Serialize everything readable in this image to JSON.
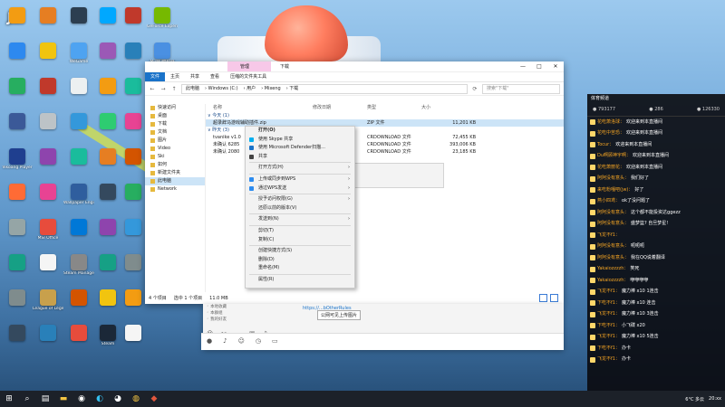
{
  "desktop": {
    "logo": "JD",
    "icons": [
      {
        "label": "",
        "color": "#f39c12"
      },
      {
        "label": "",
        "color": "#2d89ef"
      },
      {
        "label": "",
        "color": "#27ae60"
      },
      {
        "label": "",
        "color": "#3b5998"
      },
      {
        "label": "Vikoang Player",
        "color": "#1f3f8f"
      },
      {
        "label": "",
        "color": "#ff6b35"
      },
      {
        "label": "",
        "color": "#95a5a6"
      },
      {
        "label": "",
        "color": "#16a085"
      },
      {
        "label": "",
        "color": "#7f8c8d"
      },
      {
        "label": "",
        "color": "#34495e"
      },
      {
        "label": "",
        "color": "#e67e22"
      },
      {
        "label": "",
        "color": "#f1c40f"
      },
      {
        "label": "",
        "color": "#c0392b"
      },
      {
        "label": "",
        "color": "#bdc3c7"
      },
      {
        "label": "",
        "color": "#8e44ad"
      },
      {
        "label": "",
        "color": "#e84393"
      },
      {
        "label": "MSI Office",
        "color": "#e74c3c"
      },
      {
        "label": "",
        "color": "#f5f5f5"
      },
      {
        "label": "League of Legends",
        "color": "#c8a04c"
      },
      {
        "label": "",
        "color": "#2980b9"
      },
      {
        "label": "",
        "color": "#2c3e50"
      },
      {
        "label": "WeGame",
        "color": "#4ea3f1"
      },
      {
        "label": "",
        "color": "#ecf0f1"
      },
      {
        "label": "",
        "color": "#3498db"
      },
      {
        "label": "",
        "color": "#1abc9c"
      },
      {
        "label": "Wallpaper Engine",
        "color": "#2f5e9e"
      },
      {
        "label": "",
        "color": "#0078d7"
      },
      {
        "label": "Steam Manager",
        "color": "#888888"
      },
      {
        "label": "",
        "color": "#d35400"
      },
      {
        "label": "",
        "color": "#e74c3c"
      },
      {
        "label": "",
        "color": "#00a8ff"
      },
      {
        "label": "",
        "color": "#9b59b6"
      },
      {
        "label": "",
        "color": "#f39c12"
      },
      {
        "label": "",
        "color": "#2ecc71"
      },
      {
        "label": "",
        "color": "#e67e22"
      },
      {
        "label": "",
        "color": "#34495e"
      },
      {
        "label": "",
        "color": "#8e44ad"
      },
      {
        "label": "",
        "color": "#16a085"
      },
      {
        "label": "",
        "color": "#f1c40f"
      },
      {
        "label": "Steam",
        "color": "#1b2838"
      },
      {
        "label": "",
        "color": "#c0392b"
      },
      {
        "label": "",
        "color": "#2980b9"
      },
      {
        "label": "",
        "color": "#1abc9c"
      },
      {
        "label": "",
        "color": "#e84393"
      },
      {
        "label": "",
        "color": "#d35400"
      },
      {
        "label": "",
        "color": "#27ae60"
      },
      {
        "label": "",
        "color": "#3498db"
      },
      {
        "label": "",
        "color": "#7f8c8d"
      },
      {
        "label": "",
        "color": "#f39c12"
      },
      {
        "label": "",
        "color": "#f5f5f5"
      },
      {
        "label": "GeForce Experience",
        "color": "#76b900"
      },
      {
        "label": "MuMu模拟器",
        "color": "#4a90e2"
      }
    ]
  },
  "explorer": {
    "ribbon_tabs": [
      "文件",
      "主页",
      "共享",
      "查看",
      "压缩的文件夹工具"
    ],
    "title": "下载",
    "manage_tab": "管理",
    "breadcrumb": [
      "此电脑",
      "Windows (C:)",
      "用户",
      "Mixeng",
      "下载"
    ],
    "search_placeholder": "搜索\"下载\"",
    "nav_items": [
      "快速访问",
      "桌面",
      "下载",
      "文档",
      "图片",
      "Video",
      "Ski",
      "如何",
      "新建文件夹",
      "此电脑",
      "Network"
    ],
    "selected_nav": "此电脑",
    "columns": [
      "名称",
      "修改日期",
      "类型",
      "大小"
    ],
    "groups": [
      {
        "name": "今天 (1)",
        "files": [
          {
            "name": "超录辞马游戏辅助插件.zip",
            "date": "",
            "type": "ZIP 文件",
            "size": "11,201 KB",
            "selected": true
          }
        ]
      },
      {
        "name": "昨天 (3)",
        "files": [
          {
            "name": "tvanike v1.0",
            "date": "",
            "type": "CRDOWNLOAD 文件",
            "size": "72,455 KB",
            "selected": false
          },
          {
            "name": "未确认 6285",
            "date": "",
            "type": "CRDOWNLOAD 文件",
            "size": "393,006 KB",
            "selected": false
          },
          {
            "name": "未确认 2080",
            "date": "",
            "type": "CRDOWNLOAD 文件",
            "size": "23,185 KB",
            "selected": false
          }
        ]
      }
    ],
    "status_count": "4 个项目",
    "status_selected": "选中 1 个项目",
    "status_size": "11.0 MB"
  },
  "context_menu": {
    "items": [
      {
        "label": "打开(O)",
        "bold": true,
        "submenu": false,
        "icon": ""
      },
      {
        "label": "使用 Skype 共享",
        "bold": false,
        "submenu": false,
        "icon": "#00aff0"
      },
      {
        "label": "使用 Microsoft Defender扫描...",
        "bold": false,
        "submenu": false,
        "icon": "#1a73c9"
      },
      {
        "label": "共享",
        "bold": false,
        "submenu": false,
        "icon": "#444"
      },
      {
        "sep": true
      },
      {
        "label": "打开方式(H)",
        "bold": false,
        "submenu": true,
        "icon": ""
      },
      {
        "sep": true
      },
      {
        "label": "上传或同步到WPS",
        "bold": false,
        "submenu": true,
        "icon": "#2d8cf0"
      },
      {
        "label": "通过WPS发送",
        "bold": false,
        "submenu": true,
        "icon": "#2d8cf0"
      },
      {
        "sep": true
      },
      {
        "label": "授予访问权限(G)",
        "bold": false,
        "submenu": true,
        "icon": ""
      },
      {
        "label": "还原以前的版本(V)",
        "bold": false,
        "submenu": false,
        "icon": ""
      },
      {
        "sep": true
      },
      {
        "label": "发送到(N)",
        "bold": false,
        "submenu": true,
        "icon": ""
      },
      {
        "sep": true
      },
      {
        "label": "剪切(T)",
        "bold": false,
        "submenu": false,
        "icon": ""
      },
      {
        "label": "复制(C)",
        "bold": false,
        "submenu": false,
        "icon": ""
      },
      {
        "sep": true
      },
      {
        "label": "创建快捷方式(S)",
        "bold": false,
        "submenu": false,
        "icon": ""
      },
      {
        "label": "删除(D)",
        "bold": false,
        "submenu": false,
        "icon": ""
      },
      {
        "label": "重命名(M)",
        "bold": false,
        "submenu": false,
        "icon": ""
      },
      {
        "sep": true
      },
      {
        "label": "属性(R)",
        "bold": false,
        "submenu": false,
        "icon": ""
      }
    ]
  },
  "chat": {
    "link_text": "https://...bOtherRules",
    "tooltip": "公网可见上传图片",
    "left_list": [
      "本地收藏",
      "本群组",
      "我的好友"
    ],
    "toolbar_icons": [
      "smile-icon",
      "scissors-icon",
      "folder-icon",
      "image-icon",
      "mic-icon",
      "more-icon"
    ]
  },
  "stream": {
    "header": "体育频道",
    "stats": [
      "793177",
      "286",
      "126330"
    ],
    "messages": [
      {
        "badge": "",
        "user": "花吃萧洛球",
        "text": "欢迎来到本直播间"
      },
      {
        "badge": "",
        "user": "花吃中苦恐",
        "text": "欢迎来到本直播间"
      },
      {
        "badge": "",
        "user": "Tocur",
        "text": "欢迎来到本直播间"
      },
      {
        "badge": "",
        "user": "Du啊顾神宇啊",
        "text": "欢迎来到本直播间"
      },
      {
        "badge": "",
        "user": "花吃萧丽花",
        "text": "欢迎来到本直播间"
      },
      {
        "badge": "",
        "user": "阿阿没有意头",
        "text": "我们好了"
      },
      {
        "badge": "",
        "user": "来吃粉嘎吧(jw)",
        "text": "好了"
      },
      {
        "badge": "",
        "user": "燕小四鸢",
        "text": "ok了没问题了"
      },
      {
        "badge": "",
        "user": "阿阿没有意头",
        "text": "这个都不能投资达ggezz"
      },
      {
        "badge": "",
        "user": "阿阿没有意头",
        "text": "盛梦篮? 自旦梦星!"
      },
      {
        "badge": "",
        "user": "飞龙不f1",
        "text": ""
      },
      {
        "badge": "",
        "user": "阿阿没有意头",
        "text": "呃呃呃"
      },
      {
        "badge": "",
        "user": "阿阿没有意头",
        "text": "我在QQ说着翻译"
      },
      {
        "badge": "",
        "user": "Yakaiozzzzh",
        "text": "笑死"
      },
      {
        "badge": "",
        "user": "Yakaiozzzzh",
        "text": "咿咿咿咿"
      },
      {
        "badge": "",
        "user": "飞龙不f1",
        "text": "魔力棒 x10 1连击"
      },
      {
        "badge": "",
        "user": "下吃不f1",
        "text": "魔力棒 x10 连击"
      },
      {
        "badge": "",
        "user": "飞龙不f1",
        "text": "魔力棒 x10 3连击"
      },
      {
        "badge": "",
        "user": "下吃不f1",
        "text": "小飞碟 x20"
      },
      {
        "badge": "",
        "user": "飞龙不f1",
        "text": "魔力棒 x10 5连击"
      },
      {
        "badge": "",
        "user": "下吃不f1",
        "text": "办卡"
      },
      {
        "badge": "",
        "user": "飞龙不f1",
        "text": "办卡"
      }
    ]
  },
  "taskbar": {
    "weather": "6°C 多云",
    "time": "20:xx",
    "icons": [
      "windows-icon",
      "search-icon",
      "task-view-icon",
      "file-explorer-icon",
      "steam-icon",
      "edge-icon",
      "qq-icon",
      "chrome-icon",
      "app-icon"
    ]
  }
}
